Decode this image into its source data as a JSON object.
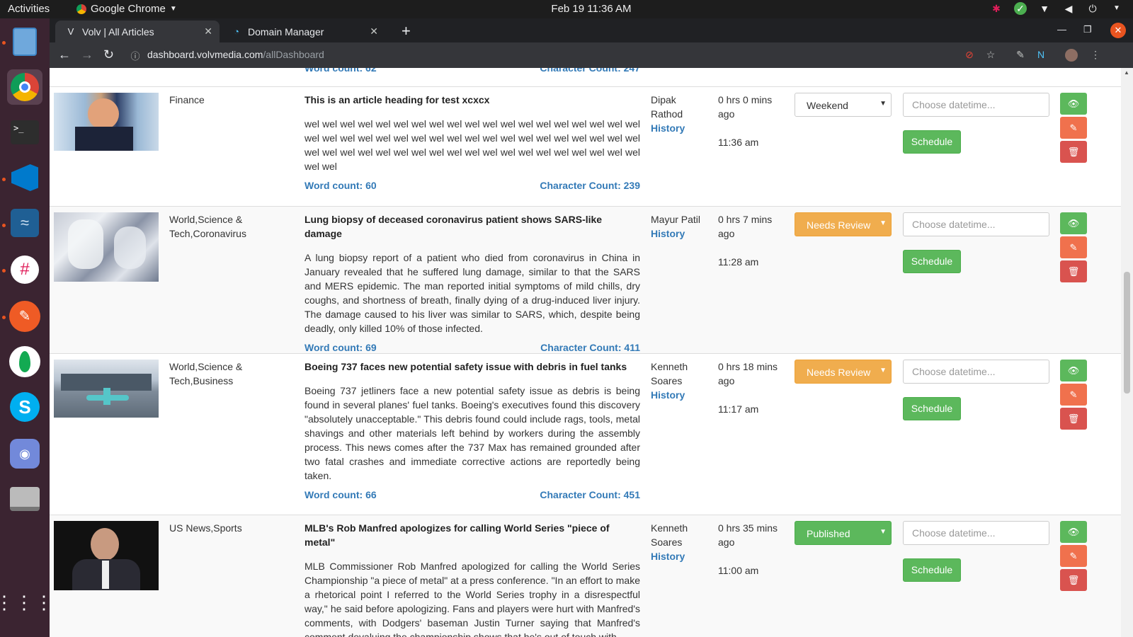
{
  "system": {
    "activities": "Activities",
    "app_name": "Google Chrome",
    "clock": "Feb 19  11:36 AM"
  },
  "dock": {
    "items": [
      "files",
      "chrome",
      "terminal",
      "vscode",
      "wireshark",
      "slack",
      "postman",
      "mongodb-compass",
      "skype",
      "discord",
      "drive",
      "app-grid"
    ]
  },
  "browser": {
    "tabs": [
      {
        "title": "Volv | All Articles",
        "active": true
      },
      {
        "title": "Domain Manager",
        "active": false
      }
    ],
    "url_host": "dashboard.volvmedia.com",
    "url_path": "/allDashboard"
  },
  "clipped_top": {
    "word_count": "Word count: 62",
    "char_count": "Character Count: 247"
  },
  "labels": {
    "history": "History",
    "schedule": "Schedule",
    "datetime_placeholder": "Choose datetime...",
    "word_count": "Word count:",
    "char_count": "Character Count:"
  },
  "articles": [
    {
      "category": "Finance",
      "title": "This is an article heading for test xcxcx",
      "body": "wel wel wel wel wel wel wel wel wel wel wel wel wel wel wel wel wel wel wel wel wel wel wel wel wel wel wel wel wel wel wel wel wel wel wel wel wel wel wel wel wel wel wel wel wel wel wel wel wel wel wel wel wel wel wel wel wel wel wel",
      "word_count": "60",
      "char_count": "239",
      "author": "Dipak Rathod",
      "ago": "0 hrs 0 mins ago",
      "time": "11:36 am",
      "status": "Weekend"
    },
    {
      "category": "World,Science & Tech,Coronavirus",
      "title": "Lung biopsy of deceased coronavirus patient shows SARS-like damage",
      "body": "A lung biopsy report of a patient who died from coronavirus in China in January revealed that he suffered lung damage, similar to that the SARS and MERS epidemic. The man reported initial symptoms of mild chills, dry coughs, and shortness of breath, finally dying of a drug-induced liver injury. The damage caused to his liver was similar to SARS, which, despite being deadly, only killed 10% of those infected.",
      "word_count": "69",
      "char_count": "411",
      "author": "Mayur Patil",
      "ago": "0 hrs 7 mins ago",
      "time": "11:28 am",
      "status": "Needs Review"
    },
    {
      "category": "World,Science & Tech,Business",
      "title": "Boeing 737 faces new potential safety issue with debris in fuel tanks",
      "body": "Boeing 737 jetliners face a new potential safety issue as debris is being found in several planes' fuel tanks. Boeing's executives found this discovery \"absolutely unacceptable.\" This debris found could include rags, tools, metal shavings and other materials left behind by workers during the assembly process. This news comes after the 737 Max has remained grounded after two fatal crashes and immediate corrective actions are reportedly being taken.",
      "word_count": "66",
      "char_count": "451",
      "author": "Kenneth Soares",
      "ago": "0 hrs 18 mins ago",
      "time": "11:17 am",
      "status": "Needs Review"
    },
    {
      "category": "US News,Sports",
      "title": "MLB's Rob Manfred apologizes for calling World Series \"piece of metal\"",
      "body": "MLB Commissioner Rob Manfred apologized for calling the World Series Championship \"a piece of metal\" at a press conference. \"In an effort to make a rhetorical point I referred to the World Series trophy in a disrespectful way,\" he said before apologizing. Fans and players were hurt with Manfred's comments, with Dodgers' baseman Justin Turner saying that Manfred's comment devaluing the championship shows that he's out of touch with",
      "word_count": "",
      "char_count": "",
      "author": "Kenneth Soares",
      "ago": "0 hrs 35 mins ago",
      "time": "11:00 am",
      "status": "Published"
    }
  ],
  "colors": {
    "link": "#337ab7",
    "count_value": "#3c763d",
    "success": "#5cb85c",
    "warning": "#f0ad4e",
    "danger": "#d9534f",
    "edit": "#f0714d",
    "dock_bg": "#3b2431"
  }
}
